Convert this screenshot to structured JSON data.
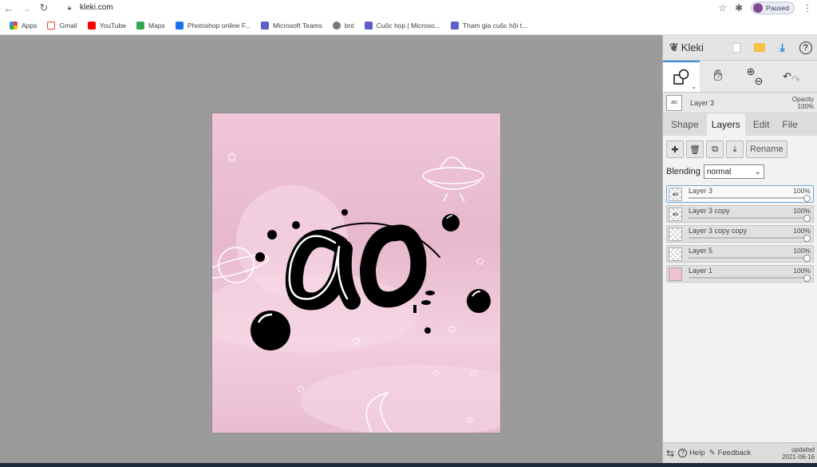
{
  "browser": {
    "url": "kleki.com",
    "profile_status": "Paused",
    "bookmarks": [
      "Apps",
      "Gmail",
      "YouTube",
      "Maps",
      "Photoshop online F...",
      "Microsoft Teams",
      "bnt",
      "Cuộc họp | Microso...",
      "Tham gia cuộc hội t..."
    ]
  },
  "app": {
    "logo": "Kleki",
    "layer_preview": {
      "name": "Layer 3",
      "opacity_label": "Opacity",
      "opacity_value": "100%"
    },
    "tabs": [
      "Shape",
      "Layers",
      "Edit",
      "File"
    ],
    "active_tab": "Layers",
    "rename_label": "Rename",
    "blending_label": "Blending",
    "blending_value": "normal",
    "layers": [
      {
        "name": "Layer 3",
        "opacity": "100%",
        "selected": true
      },
      {
        "name": "Layer 3 copy",
        "opacity": "100%",
        "selected": false
      },
      {
        "name": "Layer 3 copy copy",
        "opacity": "100%",
        "selected": false
      },
      {
        "name": "Layer 5",
        "opacity": "100%",
        "selected": false
      },
      {
        "name": "Layer 1",
        "opacity": "100%",
        "selected": false
      }
    ],
    "footer": {
      "help": "Help",
      "feedback": "Feedback",
      "updated_label": "updated",
      "updated_date": "2021-06-16"
    }
  },
  "canvas": {
    "drawing_text": "ao",
    "colors": {
      "bg": "#efc4d7",
      "ink": "#000000",
      "line": "#ffffff"
    }
  }
}
